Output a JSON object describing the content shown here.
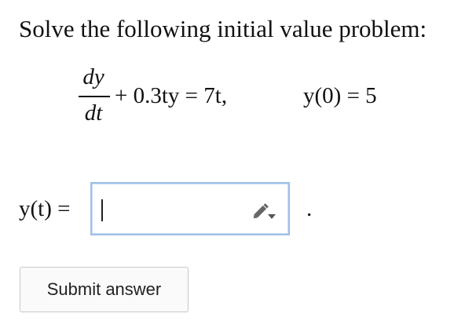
{
  "problem": {
    "prompt": "Solve the following initial value problem:",
    "equation": {
      "fraction_numerator": "dy",
      "fraction_denominator": "dt",
      "rest": "+ 0.3ty = 7t,",
      "initial_condition": "y(0) = 5"
    }
  },
  "answer": {
    "label": "y(t) =",
    "value": "",
    "trailing_punctuation": "."
  },
  "actions": {
    "submit_label": "Submit answer"
  },
  "icons": {
    "editor": "pencil-icon"
  },
  "colors": {
    "input_border": "#9fc0e6"
  }
}
